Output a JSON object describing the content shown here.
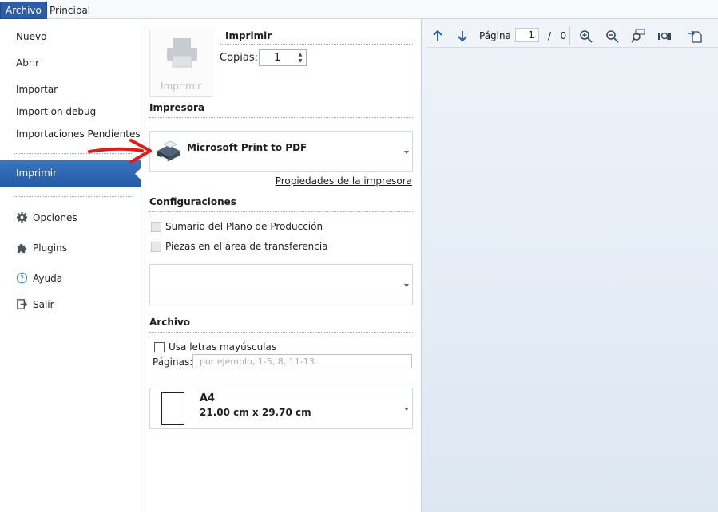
{
  "menu": {
    "tabs": [
      {
        "label": "Archivo"
      },
      {
        "label": "Principal"
      }
    ]
  },
  "nav": {
    "items": [
      {
        "label": "Nuevo"
      },
      {
        "label": "Abrir"
      },
      {
        "label": "Importar"
      },
      {
        "label": "Import on debug"
      },
      {
        "label": "Importaciones Pendientes"
      }
    ],
    "active": "Imprimir",
    "bottom": [
      {
        "label": "Opciones",
        "icon": "gear-icon"
      },
      {
        "label": "Plugins",
        "icon": "puzzle-icon"
      },
      {
        "label": "Ayuda",
        "icon": "help-icon"
      },
      {
        "label": "Salir",
        "icon": "exit-icon"
      }
    ]
  },
  "print": {
    "button_label": "Imprimir",
    "title": "Imprimir",
    "copies_label": "Copias:",
    "copies_value": "1"
  },
  "printer": {
    "section_title": "Impresora",
    "name": "Microsoft Print to PDF",
    "properties_link": "Propiedades de la impresora"
  },
  "settings": {
    "section_title": "Configuraciones",
    "options": [
      {
        "label": "Sumario del Plano de Producción",
        "checked": false
      },
      {
        "label": "Piezas en el área de transferencia",
        "checked": false
      }
    ]
  },
  "file": {
    "section_title": "Archivo",
    "uppercase_label": "Usa letras mayúsculas",
    "pages_label": "Páginas:",
    "pages_placeholder": "por ejemplo, 1-5, 8, 11-13"
  },
  "paper": {
    "name": "A4",
    "size": "21.00 cm x 29.70 cm"
  },
  "preview": {
    "page_label": "Página",
    "page_value": "1",
    "page_sep": "/",
    "page_total": "0"
  },
  "colors": {
    "accent": "#2b5ea6",
    "annotation": "#e01b1b"
  }
}
